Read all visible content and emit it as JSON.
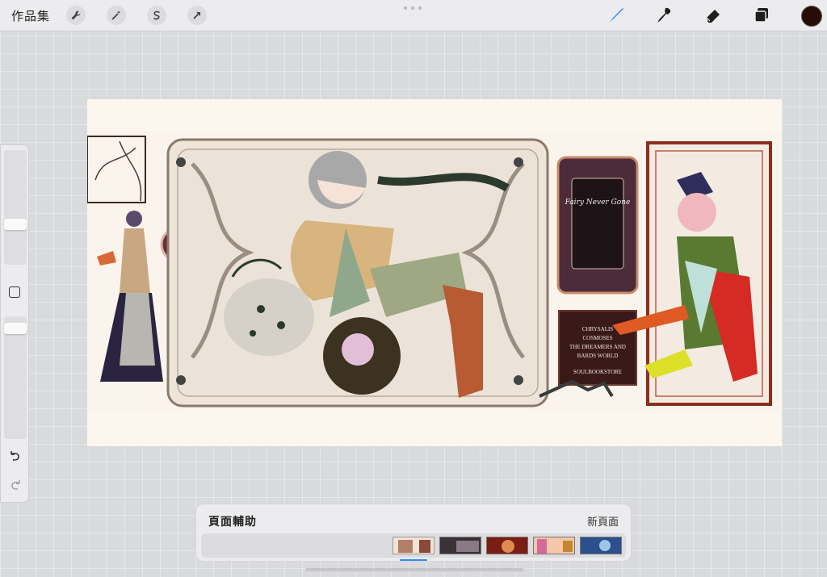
{
  "topbar": {
    "gallery_label": "作品集",
    "left_tools": [
      {
        "name": "wrench-icon"
      },
      {
        "name": "magic-wand-icon"
      },
      {
        "name": "selection-s-icon"
      },
      {
        "name": "arrow-transform-icon"
      }
    ],
    "right_tools": [
      {
        "name": "brush-icon",
        "active": true
      },
      {
        "name": "smudge-icon"
      },
      {
        "name": "eraser-icon"
      },
      {
        "name": "layers-icon"
      }
    ],
    "current_color": "#2a0c06",
    "accent_color": "#2a8bf2"
  },
  "canvas": {
    "book_title_lines": [
      "CHRYSALIS",
      "COSMOSES",
      "THE DREAMERS AND",
      "BARDS WORLD"
    ],
    "publisher": "SOULBOOKSTORE",
    "card_script": "Fairy Never Gone"
  },
  "page_panel": {
    "title": "頁面輔助",
    "new_page_label": "新頁面",
    "thumbnails": [
      {
        "name": "page-thumb-1",
        "color_a": "#f1e4d2",
        "color_b": "#b0806a",
        "selected": true
      },
      {
        "name": "page-thumb-2",
        "color_a": "#3a3236",
        "color_b": "#8a7a86",
        "selected": false
      },
      {
        "name": "page-thumb-3",
        "color_a": "#7a1e14",
        "color_b": "#e08a52",
        "selected": false
      },
      {
        "name": "page-thumb-4",
        "color_a": "#f3c7a8",
        "color_b": "#d36a9a",
        "selected": false
      },
      {
        "name": "page-thumb-5",
        "color_a": "#2c4f8e",
        "color_b": "#9fc6e9",
        "selected": false
      }
    ]
  }
}
